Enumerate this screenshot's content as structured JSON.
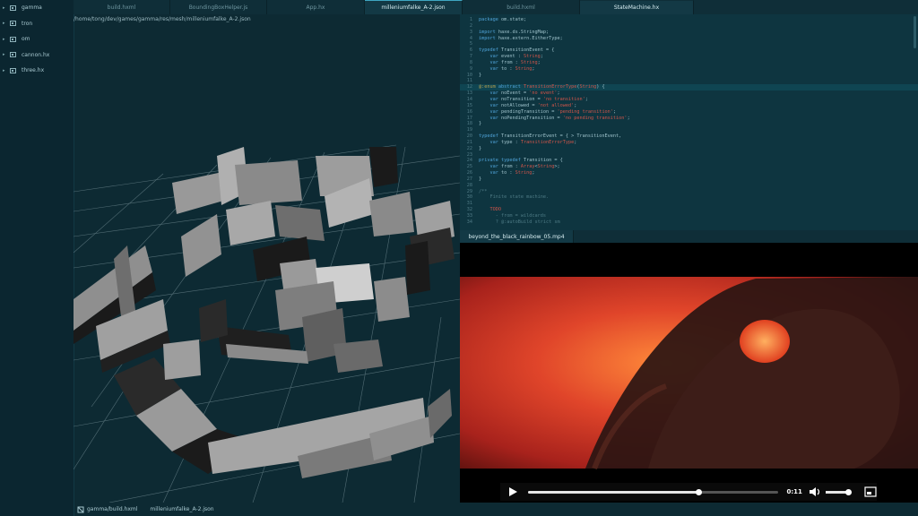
{
  "sidebar": {
    "items": [
      {
        "label": "gamma"
      },
      {
        "label": "tron"
      },
      {
        "label": "om"
      },
      {
        "label": "cannon.hx"
      },
      {
        "label": "three.hx"
      }
    ]
  },
  "tabs": [
    {
      "label": "build.hxml"
    },
    {
      "label": "BoundingBoxHelper.js"
    },
    {
      "label": "App.hx"
    },
    {
      "label": "milleniumfalke_A-2.json"
    },
    {
      "label": "build.hxml"
    },
    {
      "label": "StateMachine.hx"
    }
  ],
  "viewport": {
    "path": "/home/tong/dev/games/gamma/res/mesh/milleniumfalke_A-2.json"
  },
  "editor": {
    "lines": [
      {
        "n": "1",
        "t": "package om.state;"
      },
      {
        "n": "2",
        "t": ""
      },
      {
        "n": "3",
        "t": "import haxe.ds.StringMap;"
      },
      {
        "n": "4",
        "t": "import haxe.extern.EitherType;"
      },
      {
        "n": "5",
        "t": ""
      },
      {
        "n": "6",
        "t": "typedef TransitionEvent = {"
      },
      {
        "n": "7",
        "t": "    var event : String;"
      },
      {
        "n": "8",
        "t": "    var from : String;"
      },
      {
        "n": "9",
        "t": "    var to : String;"
      },
      {
        "n": "10",
        "t": "}"
      },
      {
        "n": "11",
        "t": ""
      },
      {
        "n": "12",
        "t": "@:enum abstract TransitionErrorType(String) {"
      },
      {
        "n": "13",
        "t": "    var noEvent = 'no event';"
      },
      {
        "n": "14",
        "t": "    var noTransition = 'no transition';"
      },
      {
        "n": "15",
        "t": "    var notAllowed = 'not allowed';"
      },
      {
        "n": "16",
        "t": "    var pendingTransition = 'pending transition';"
      },
      {
        "n": "17",
        "t": "    var noPendingTransition = 'no pending transition';"
      },
      {
        "n": "18",
        "t": "}"
      },
      {
        "n": "19",
        "t": ""
      },
      {
        "n": "20",
        "t": "typedef TransitionErrorEvent = { > TransitionEvent,"
      },
      {
        "n": "21",
        "t": "    var type : TransitionErrorType;"
      },
      {
        "n": "22",
        "t": "}"
      },
      {
        "n": "23",
        "t": ""
      },
      {
        "n": "24",
        "t": "private typedef Transition = {"
      },
      {
        "n": "25",
        "t": "    var from : Array<String>;"
      },
      {
        "n": "26",
        "t": "    var to : String;"
      },
      {
        "n": "27",
        "t": "}"
      },
      {
        "n": "28",
        "t": ""
      },
      {
        "n": "29",
        "t": "/**"
      },
      {
        "n": "30",
        "t": "    Finite state machine."
      },
      {
        "n": "31",
        "t": ""
      },
      {
        "n": "32",
        "t": "    TODO"
      },
      {
        "n": "33",
        "t": "      - from = wildcards"
      },
      {
        "n": "34",
        "t": "      ? @:autoBuild strict sm"
      }
    ]
  },
  "video": {
    "tab_label": "beyond_the_black_rainbow_05.mp4",
    "time": "0:11",
    "progress": 0.68,
    "volume": 0.85
  },
  "bottombar": {
    "items": [
      {
        "label": "gamma/build.hxml"
      },
      {
        "label": "milleniumfalke_A-2.json"
      }
    ]
  },
  "colors": {
    "background": "#0d2a33",
    "sidebar": "#0b2630",
    "editor_bg": "#0e3540",
    "keyword": "#4fa3d8",
    "string": "#d0554a",
    "accent": "#3fa7c2"
  },
  "icons": {
    "tree": "folder-icon",
    "play": "play-icon",
    "volume": "volume-icon",
    "fullscreen": "fullscreen-icon"
  }
}
